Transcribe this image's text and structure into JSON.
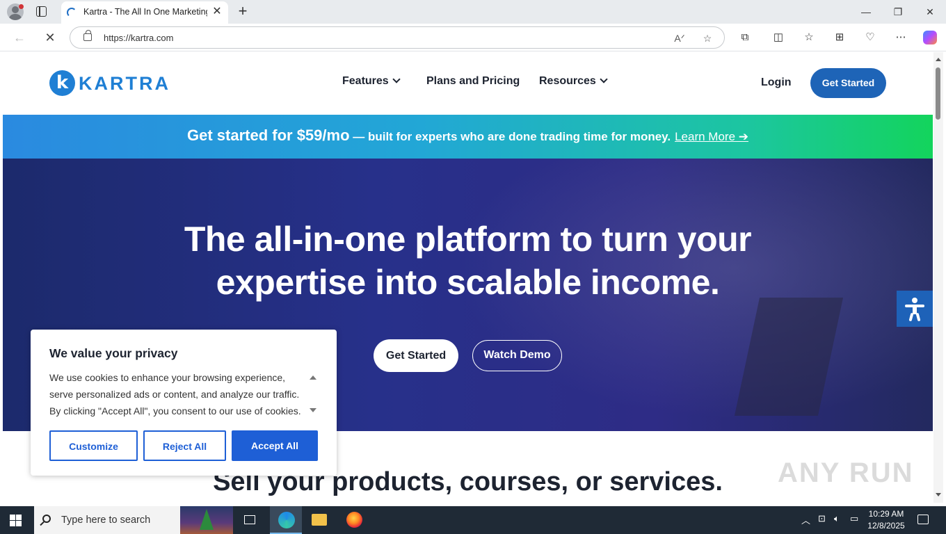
{
  "browser": {
    "tab_title": "Kartra - The All In One Marketing",
    "tab_close": "✕",
    "new_tab": "+",
    "url": "https://kartra.com",
    "window_controls": [
      "—",
      "❐",
      "✕"
    ]
  },
  "site": {
    "logo_mark": "k",
    "logo_text": "KARTRA",
    "nav": {
      "features": "Features",
      "plans": "Plans and Pricing",
      "resources": "Resources"
    },
    "login": "Login",
    "header_cta": "Get Started",
    "banner": {
      "headline": "Get started for $59/mo",
      "rest": " — built for experts who are done trading time for money.",
      "link": "Learn More ➔"
    },
    "hero": {
      "title_line1": "The all-in-one platform to turn your",
      "title_line2": "expertise into scalable income.",
      "primary_button": "Get Started",
      "secondary_button": "Watch Demo"
    },
    "section_heading": "Sell your products, courses, or services.",
    "watermark": "ANY RUN"
  },
  "cookie": {
    "title": "We value your privacy",
    "text": "We use cookies to enhance your browsing experience, serve personalized ads or content, and analyze our traffic. By clicking \"Accept All\", you consent to our use of cookies.",
    "customize": "Customize",
    "reject": "Reject All",
    "accept": "Accept All"
  },
  "taskbar": {
    "search_placeholder": "Type here to search",
    "time": "10:29 AM",
    "date": "12/8/2025"
  },
  "colors": {
    "brand_blue": "#1f7fd4",
    "cta_blue": "#1e64b7",
    "cookie_blue": "#1e5fd6",
    "hero_bg": "#27308a"
  }
}
